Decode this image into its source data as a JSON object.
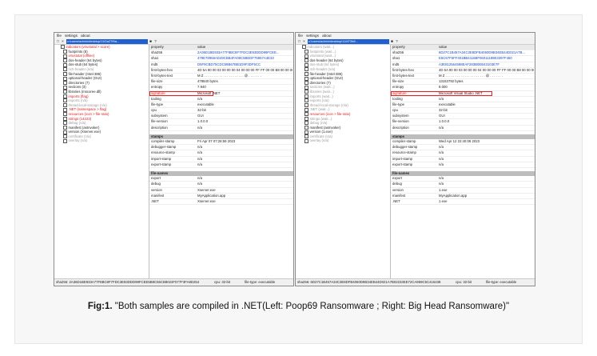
{
  "caption": {
    "label": "Fig:1.",
    "text": "\"Both samples are compiled in  .NET(Left: Poop69 Ransomware ; Right: Big Head Ransomware)\""
  },
  "colors": {
    "accent": "#1f5fcf",
    "highlight": "#e12222"
  },
  "columns": {
    "property": "property",
    "value": "value"
  },
  "left": {
    "menu": [
      "file",
      "settings",
      "about"
    ],
    "path": "c:\\users\\admin\\desktop\\11f2a27f9a...",
    "tree": [
      {
        "label": "indicators (virustotal > score)",
        "color": "red"
      },
      {
        "label": "footprints (8)",
        "color": "normal"
      },
      {
        "label": "virustotal (offline)",
        "color": "red"
      },
      {
        "label": "dos-header (64 bytes)",
        "color": "normal"
      },
      {
        "label": "dos-stub (64 bytes)",
        "color": "normal"
      },
      {
        "label": "rich-header (n/a)",
        "color": "grey"
      },
      {
        "label": "file-header (Intel-386)",
        "color": "normal"
      },
      {
        "label": "optional-header (GUI)",
        "color": "normal"
      },
      {
        "label": "directories (7)",
        "color": "normal"
      },
      {
        "label": "sections (3)",
        "color": "normal"
      },
      {
        "label": "libraries (mscoree.dll)",
        "color": "normal"
      },
      {
        "label": "imports (flag)",
        "color": "red"
      },
      {
        "label": "exports (n/a)",
        "color": "grey"
      },
      {
        "label": "thread-local-storage (n/a)",
        "color": "grey"
      },
      {
        "label": ".NET (namespace > flag)",
        "color": "red"
      },
      {
        "label": "resources (icon > file-ratio)",
        "color": "red"
      },
      {
        "label": "strings (14223)",
        "color": "red"
      },
      {
        "label": "debug (n/a)",
        "color": "grey"
      },
      {
        "label": "manifest (asInvoker)",
        "color": "normal"
      },
      {
        "label": "version (Xserver.exe)",
        "color": "normal"
      },
      {
        "label": "certificate (n/a)",
        "color": "grey"
      },
      {
        "label": "overlay (n/a)",
        "color": "grey"
      }
    ],
    "props": [
      {
        "k": "sha256",
        "v": "2A36D1BE933A77F8BC8F7FDC3E93DDD99FCEE...",
        "link": true
      },
      {
        "k": "sha1",
        "v": "479E78966AD49CBB4FA08C5BEDF75957A4E33",
        "link": true
      },
      {
        "k": "md5",
        "v": "D5F9CBD75CDC59B67BB1D9F3DF5CC",
        "link": true
      },
      {
        "k": "first-bytes-hex",
        "v": "4D 5A 90 00 03 00 00 00 04 00 00 00 FF FF 00 00 B8 00 00 00"
      },
      {
        "k": "first-bytes-text",
        "v": "M Z . . . . . . . . . . . . . . . . . . . . . @ . . . . . . ."
      },
      {
        "k": "file-size",
        "v": "478840 bytes"
      },
      {
        "k": "entropy",
        "v": "7.940"
      },
      {
        "k": "signature",
        "v": "Microsoft .NET",
        "highlight": true
      },
      {
        "k": "tooling",
        "v": "n/a"
      },
      {
        "k": "file-type",
        "v": "executable"
      },
      {
        "k": "cpu",
        "v": "32-bit"
      },
      {
        "k": "subsystem",
        "v": "GUI"
      },
      {
        "k": "file-version",
        "v": "1.0.0.0"
      },
      {
        "k": "description",
        "v": "n/a"
      }
    ],
    "stamps_title": "stamps",
    "stamps": [
      {
        "k": "compiler-stamp",
        "v": "Fri Apr 07 07:28:59 2023"
      },
      {
        "k": "debugger-stamp",
        "v": "n/a"
      },
      {
        "k": "resource-stamp",
        "v": "n/a"
      },
      {
        "k": "import-stamp",
        "v": "n/a"
      },
      {
        "k": "export-stamp",
        "v": "n/a"
      }
    ],
    "names_title": "file-names",
    "names": [
      {
        "k": "export",
        "v": "n/a"
      },
      {
        "k": "debug",
        "v": "n/a"
      },
      {
        "k": "version",
        "v": "Xserver.exe"
      },
      {
        "k": "manifest",
        "v": "MyApplication.app"
      },
      {
        "k": ".NET",
        "v": "Xserver.exe"
      }
    ],
    "status": {
      "hash": "sha256: 2A36D1BE933A77F8BC8F7FDC3E93DDD99FCEE5B8C55CB8022F077F3FA8D254",
      "cpu": "cpu: 32-bit",
      "type": "file-type: executable"
    }
  },
  "right": {
    "menu": [
      "file",
      "settings",
      "about"
    ],
    "path": "c:\\users\\admin\\desktop\\116f72b8...",
    "tree": [
      {
        "label": "indicators (wait...)",
        "color": "grey"
      },
      {
        "label": "footprints (wait...)",
        "color": "grey"
      },
      {
        "label": "virustotal (wait...)",
        "color": "grey"
      },
      {
        "label": "dos-header (64 bytes)",
        "color": "normal"
      },
      {
        "label": "dos-stub (64 bytes)",
        "color": "grey"
      },
      {
        "label": "rich-header (n/a)",
        "color": "grey"
      },
      {
        "label": "file-header (Intel-386)",
        "color": "normal"
      },
      {
        "label": "optional-header (GUI)",
        "color": "normal"
      },
      {
        "label": "directories (7)",
        "color": "normal"
      },
      {
        "label": "sections (wait...)",
        "color": "grey"
      },
      {
        "label": "libraries (wait...)",
        "color": "grey"
      },
      {
        "label": "imports (wait...)",
        "color": "grey"
      },
      {
        "label": "exports (n/a)",
        "color": "grey"
      },
      {
        "label": "thread-local-storage (n/a)",
        "color": "grey"
      },
      {
        "label": ".NET (wait...)",
        "color": "grey"
      },
      {
        "label": "resources (icon > file-ratio)",
        "color": "red"
      },
      {
        "label": "strings (wait...)",
        "color": "grey"
      },
      {
        "label": "debug (n/a)",
        "color": "grey"
      },
      {
        "label": "manifest (asInvoker)",
        "color": "normal"
      },
      {
        "label": "version (1.exe)",
        "color": "normal"
      },
      {
        "label": "certificate (n/a)",
        "color": "grey"
      },
      {
        "label": "overlay (n/a)",
        "color": "grey"
      }
    ],
    "props": [
      {
        "k": "sha256",
        "v": "6D27C1B457A34C3E8DFB4060D9B34EB44D021A7B...",
        "link": true
      },
      {
        "k": "sha1",
        "v": "E5C67F5FF401BB4116BF06011189E3397F460",
        "link": true
      },
      {
        "k": "md5",
        "v": "A3E812564598EAF283B0EB43103E7F",
        "link": true
      },
      {
        "k": "first-bytes-hex",
        "v": "4D 5A 90 00 03 00 00 00 04 00 00 00 FF FF 00 00 B8 00 00 00"
      },
      {
        "k": "first-bytes-text",
        "v": "M Z . . . . . . . . . . . . . . . . . . . . . @ . . . . . . ."
      },
      {
        "k": "file-size",
        "v": "13153792 bytes"
      },
      {
        "k": "entropy",
        "v": "8.000"
      },
      {
        "k": "signature",
        "v": "Microsoft Visual Studio .NET",
        "highlight": true
      },
      {
        "k": "tooling",
        "v": "n/a"
      },
      {
        "k": "file-type",
        "v": "executable"
      },
      {
        "k": "cpu",
        "v": "32-bit"
      },
      {
        "k": "subsystem",
        "v": "GUI"
      },
      {
        "k": "file-version",
        "v": "1.0.0.0"
      },
      {
        "k": "description",
        "v": "n/a"
      }
    ],
    "stamps_title": "stamps",
    "stamps": [
      {
        "k": "compiler-stamp",
        "v": "Wed Apr 12 22:40:08 2023"
      },
      {
        "k": "debugger-stamp",
        "v": "n/a"
      },
      {
        "k": "resource-stamp",
        "v": "n/a"
      },
      {
        "k": "import-stamp",
        "v": "n/a"
      },
      {
        "k": "export-stamp",
        "v": "n/a"
      }
    ],
    "names_title": "file-names",
    "names": [
      {
        "k": "export",
        "v": "n/a"
      },
      {
        "k": "debug",
        "v": "n/a"
      },
      {
        "k": "version",
        "v": "1.exe"
      },
      {
        "k": "manifest",
        "v": "MyApplication.app"
      },
      {
        "k": ".NET",
        "v": "1.exe"
      }
    ],
    "status": {
      "hash": "sha256: 6D27C1B457A34C3E8DFB4060D9B34EB44D021A7B02233EE72CA959C5C415438",
      "cpu": "cpu: 32-bit",
      "type": "file-type: executable"
    }
  }
}
